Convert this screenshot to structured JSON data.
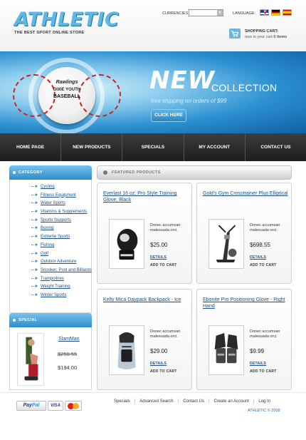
{
  "header": {
    "logo": "ATHLETIC",
    "tagline": "THE BEST SPORT ONLINE STORE",
    "currencies_label": "CURRENCIES:",
    "currencies_value": "",
    "language_label": "LANGUAGE:",
    "languages": [
      "english-flag",
      "german-flag",
      "spanish-flag"
    ],
    "cart_title": "SHOPPING CART:",
    "cart_text": "now in your cart",
    "cart_count": "0 items"
  },
  "banner": {
    "ball_brand": "Rawlings",
    "ball_line1": "DIXIE YOUTH",
    "ball_line2": "BASEBALL",
    "headline": "NEW",
    "headline_sub": "COLLECTION",
    "free_shipping": "free shipping on orders of $99",
    "button": "CLICK HERE"
  },
  "nav": {
    "items": [
      "HOME PAGE",
      "NEW PRODUCTS",
      "SPECIALS",
      "MY ACCOUNT",
      "CONTACT US"
    ]
  },
  "sidebar": {
    "category_title": "CATEGORY",
    "categories": [
      "Cycling",
      "Fitness Equipment",
      "Water Sports",
      "Vitamins & Supplements",
      "Sports Supports",
      "Boxing",
      "Extreme Sports",
      "Fishing",
      "Golf",
      "Outdoor Adventure",
      "Snooker, Pool and Billiards",
      "Trampolines",
      "Weight Training",
      "Winter Sports"
    ],
    "special_title": "SPECIAL",
    "special": {
      "name": "SlamMan",
      "old_price": "$250.55",
      "new_price": "$194.00"
    }
  },
  "featured": {
    "title": "FEATURED PRODUCTS",
    "products": [
      {
        "title": "Everlast 16 oz. Pro Style Training Glove, Black",
        "desc": "Donec accumsan malesuada orci.",
        "price": "$25.00",
        "details": "DETAILS",
        "add": "ADD TO CART"
      },
      {
        "title": "Gold's Gym Crosstrainer Plus Elliptical",
        "desc": "Donec accumsan malesuada orci.",
        "price": "$698.55",
        "details": "DETAILS",
        "add": "ADD TO CART"
      },
      {
        "title": "Kelty Mica Daypack Backpack - Ice",
        "desc": "Donec accumsan malesuada orci.",
        "price": "$29.00",
        "details": "DETAILS",
        "add": "ADD TO CART"
      },
      {
        "title": "Ebonite Pro Positioning Glove - Right Hand",
        "desc": "Donec accumsan malesuada orci.",
        "price": "$9.99",
        "details": "DETAILS",
        "add": "ADD TO CART"
      }
    ]
  },
  "footer": {
    "payments": {
      "paypal_a": "Pay",
      "paypal_b": "Pal",
      "visa": "VISA",
      "mastercard": "mastercard"
    },
    "links": [
      "Specials",
      "Advanced Search",
      "Contact Us",
      "Create an Account",
      "Log In"
    ],
    "copyright": "ATHLETIC © 2008"
  },
  "colors": {
    "accent": "#2e8ccb",
    "link": "#1a4f8a",
    "nav_bg": "#2a2a2a",
    "banner_blue": "#1a6fb5"
  }
}
